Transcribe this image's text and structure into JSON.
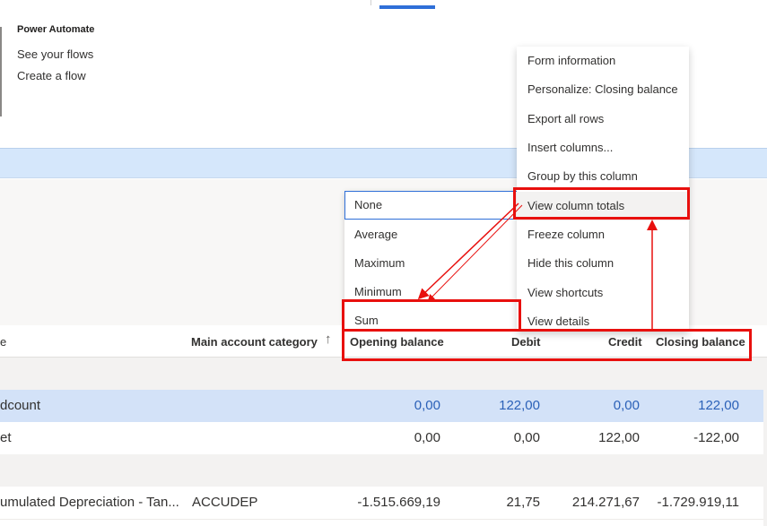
{
  "power_automate": {
    "title": "Power Automate",
    "links": [
      "See your flows",
      "Create a flow"
    ]
  },
  "aggregate_dropdown": {
    "options": [
      "None",
      "Average",
      "Maximum",
      "Minimum",
      "Sum"
    ],
    "selected": "None"
  },
  "context_menu": {
    "items": [
      "Form information",
      "Personalize: Closing balance",
      "Export all rows",
      "Insert columns...",
      "Group by this column",
      "View column totals",
      "Freeze column",
      "Hide this column",
      "View shortcuts",
      "View details"
    ],
    "hovered": "View column totals"
  },
  "grid": {
    "columns": {
      "name": "e",
      "category": "Main account category",
      "opening": "Opening balance",
      "debit": "Debit",
      "credit": "Credit",
      "closing": "Closing balance"
    },
    "sort_icon": "arrow-up-icon",
    "rows": [
      {
        "name": "",
        "category": "",
        "opening": "",
        "debit": "",
        "credit": "",
        "closing": ""
      },
      {
        "name": "dcount",
        "category": "",
        "opening": "0,00",
        "debit": "122,00",
        "credit": "0,00",
        "closing": "122,00"
      },
      {
        "name": "et",
        "category": "",
        "opening": "0,00",
        "debit": "0,00",
        "credit": "122,00",
        "closing": "-122,00"
      },
      {
        "name": "",
        "category": "",
        "opening": "",
        "debit": "",
        "credit": "",
        "closing": ""
      },
      {
        "name": "umulated Depreciation - Tan...",
        "category": "ACCUDEP",
        "opening": "-1.515.669,19",
        "debit": "21,75",
        "credit": "214.271,67",
        "closing": "-1.729.919,11"
      }
    ]
  },
  "colors": {
    "accent": "#2f6fd8",
    "highlight": "#e8100e",
    "selected_row": "#d3e2f8",
    "band": "#d5e7fb"
  }
}
